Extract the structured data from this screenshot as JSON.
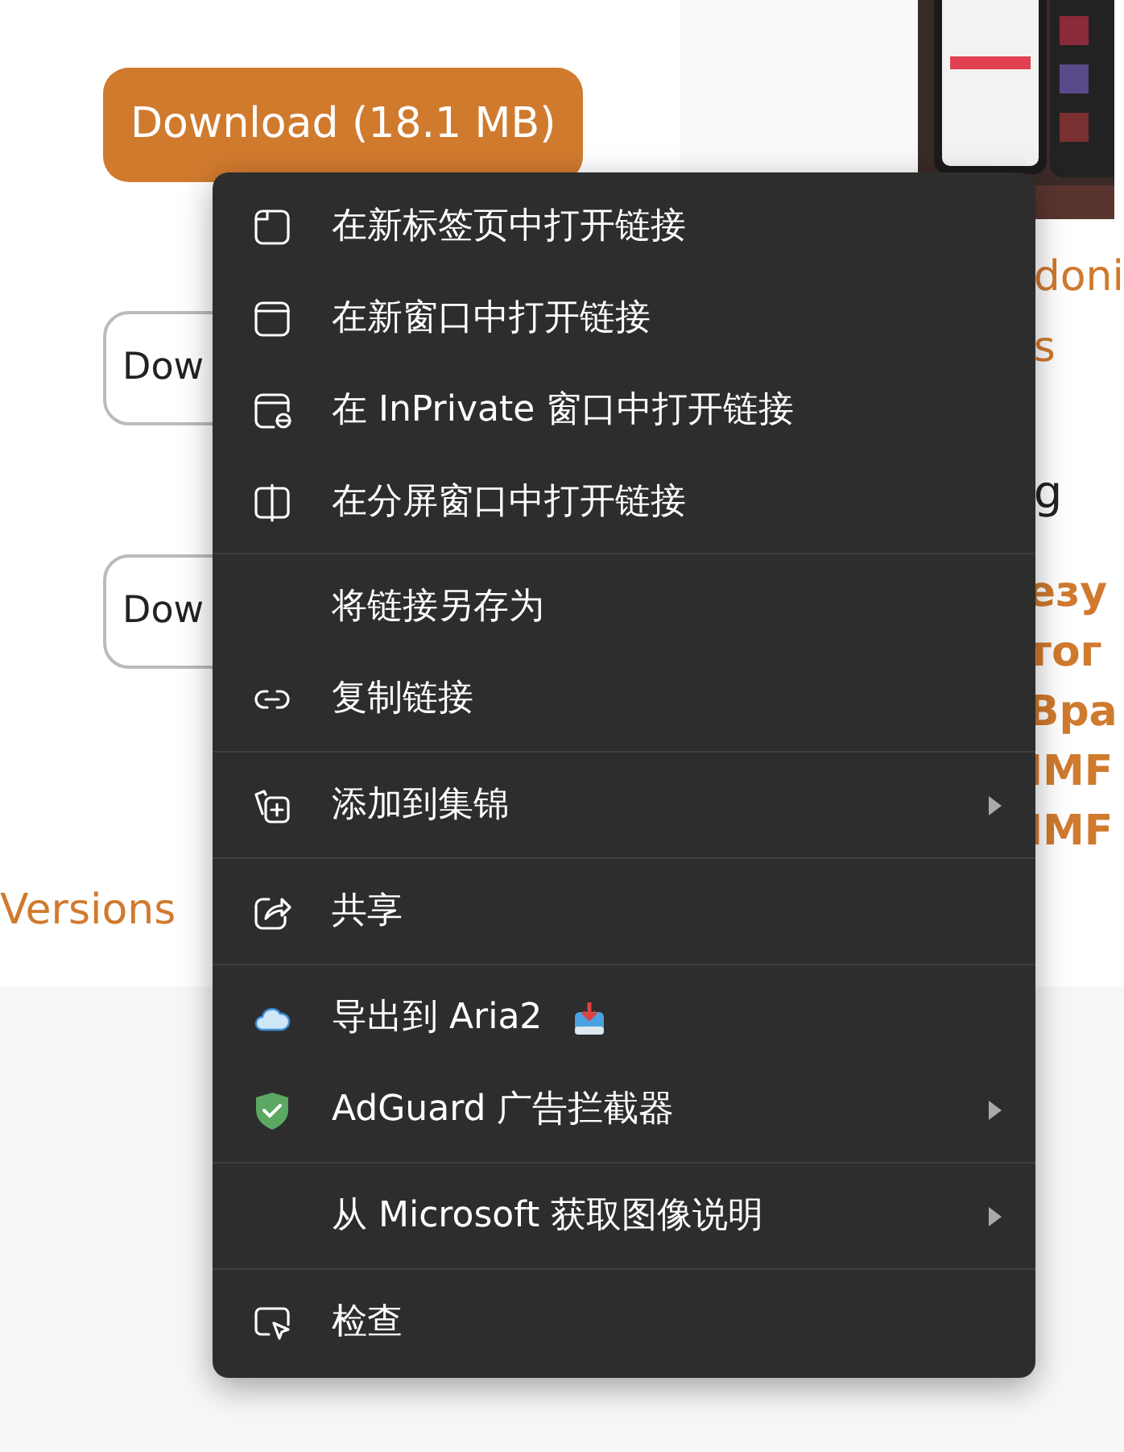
{
  "page": {
    "primary_button": "Download (18.1 MB)",
    "secondary_buttons": [
      "Dow",
      "Dow"
    ],
    "versions_link": "Versions",
    "side": {
      "link_lines": [
        "doni",
        "s"
      ],
      "heading": "g",
      "bold_lines": [
        "езу",
        "тог",
        "Вра",
        "IMF",
        "IMF"
      ]
    }
  },
  "context_menu": {
    "sections": [
      [
        {
          "label": "在新标签页中打开链接",
          "submenu": false
        },
        {
          "label": "在新窗口中打开链接",
          "submenu": false
        },
        {
          "label": "在 InPrivate 窗口中打开链接",
          "submenu": false
        },
        {
          "label": "在分屏窗口中打开链接",
          "submenu": false
        }
      ],
      [
        {
          "label": "将链接另存为",
          "submenu": false
        },
        {
          "label": "复制链接",
          "submenu": false
        }
      ],
      [
        {
          "label": "添加到集锦",
          "submenu": true
        }
      ],
      [
        {
          "label": "共享",
          "submenu": false
        }
      ],
      [
        {
          "label": "导出到 Aria2",
          "submenu": false
        },
        {
          "label": "AdGuard 广告拦截器",
          "submenu": true
        }
      ],
      [
        {
          "label": "从 Microsoft 获取图像说明",
          "submenu": true
        }
      ],
      [
        {
          "label": "检查",
          "submenu": false
        }
      ]
    ]
  }
}
